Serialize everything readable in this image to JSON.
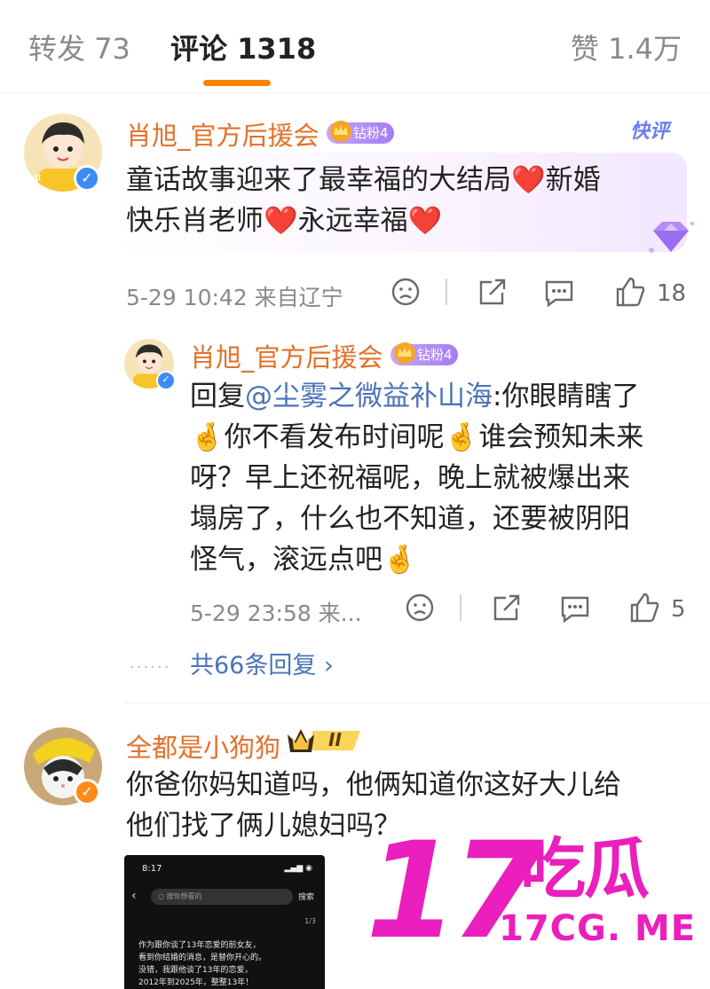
{
  "tabs": {
    "repost": "转发 73",
    "comment": "评论 1318",
    "like": "赞 1.4万"
  },
  "comment1": {
    "username": "肖旭_官方后援会",
    "badge": "钻粉4",
    "quick_comment": "快评",
    "text_line1": "童话故事迎来了最幸福的大结局❤️新婚",
    "text_line2": "快乐肖老师❤️永远幸福❤️",
    "meta": "5-29 10:42 来自辽宁",
    "like_count": "18"
  },
  "reply1": {
    "username": "肖旭_官方后援会",
    "badge": "钻粉4",
    "reply_prefix": "回复",
    "mention": "@尘雾之微益补山海",
    "line1_rest": ":你眼睛瞎了",
    "line2": "🤞你不看发布时间呢🤞谁会预知未来",
    "line3": "呀？早上还祝福呢，晚上就被爆出来",
    "line4": "塌房了，什么也不知道，还要被阴阳",
    "line5": "怪气，滚远点吧🤞",
    "meta": "5-29 23:58 来...",
    "like_count": "5",
    "more_replies": "共66条回复 ›",
    "dots": "······"
  },
  "comment2": {
    "username": "全都是小狗狗",
    "level_badge": "II",
    "text_line1": "你爸你妈知道吗，他俩知道你这好大儿给",
    "text_line2": "他们找了俩儿媳妇吗？"
  },
  "phone_screenshot": {
    "time": "8:17",
    "status_icons": "▂▄▆ ◉",
    "back": "‹",
    "search_placeholder": "○ 搜你想看的",
    "search_button": "搜索",
    "page": "1/3",
    "line1": "作为跟你谈了13年恋爱的前女友，",
    "line2": "看到你结婚的消息，是替你开心的。",
    "line3": "没错，我跟他谈了13年的恋爱，",
    "line4": "2012年到2025年，整整13年！"
  },
  "watermark": {
    "number": "17",
    "name": "吃瓜",
    "url": "17CG. ME"
  },
  "colors": {
    "accent_orange": "#ff8200",
    "username": "#e3702a",
    "mention": "#4a73b8",
    "watermark": "#ea1fbd"
  }
}
